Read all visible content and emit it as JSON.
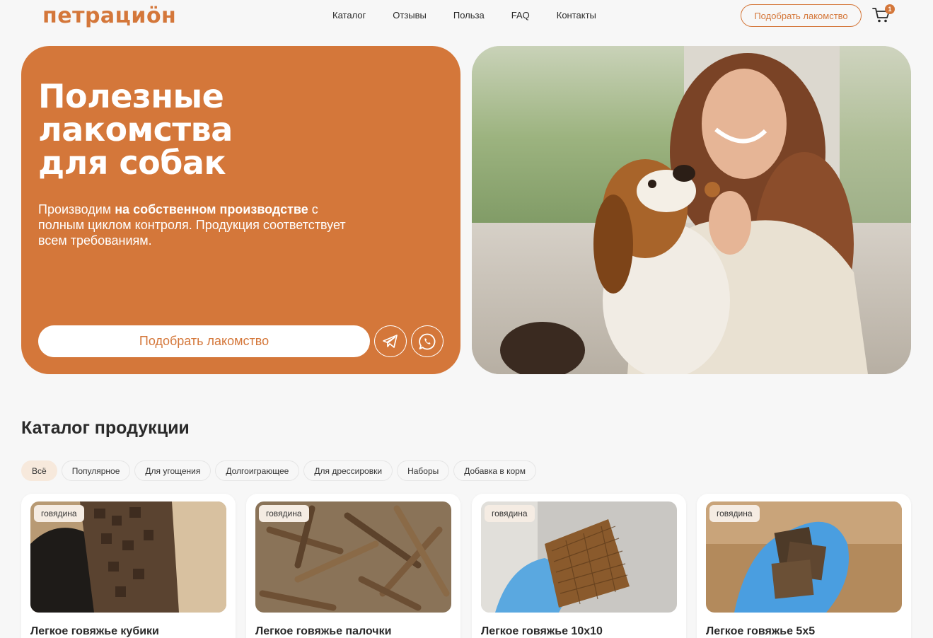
{
  "header": {
    "logo": "петрациӧн",
    "nav": [
      "Каталог",
      "Отзывы",
      "Польза",
      "FAQ",
      "Контакты"
    ],
    "cta": "Подобрать лакомство",
    "cart_count": "1"
  },
  "hero": {
    "title_lines": [
      "Полезные",
      "лакомства",
      "для собак"
    ],
    "subtitle_prefix": "Производим ",
    "subtitle_bold": "на собственном производстве",
    "subtitle_rest": " с полным циклом контроля. Продукция соответствует всем требованиям.",
    "button": "Подобрать лакомство",
    "accent_color": "#d4773a"
  },
  "catalog": {
    "title": "Каталог продукции",
    "filters": [
      "Всё",
      "Популярное",
      "Для угощения",
      "Долгоиграющее",
      "Для дрессировки",
      "Наборы",
      "Добавка в корм"
    ],
    "active_filter": 0,
    "products": [
      {
        "tag": "говядина",
        "name": "Легкое говяжье кубики"
      },
      {
        "tag": "говядина",
        "name": "Легкое говяжье палочки"
      },
      {
        "tag": "говядина",
        "name": "Легкое говяжье 10х10"
      },
      {
        "tag": "говядина",
        "name": "Легкое говяжье 5х5"
      }
    ]
  }
}
